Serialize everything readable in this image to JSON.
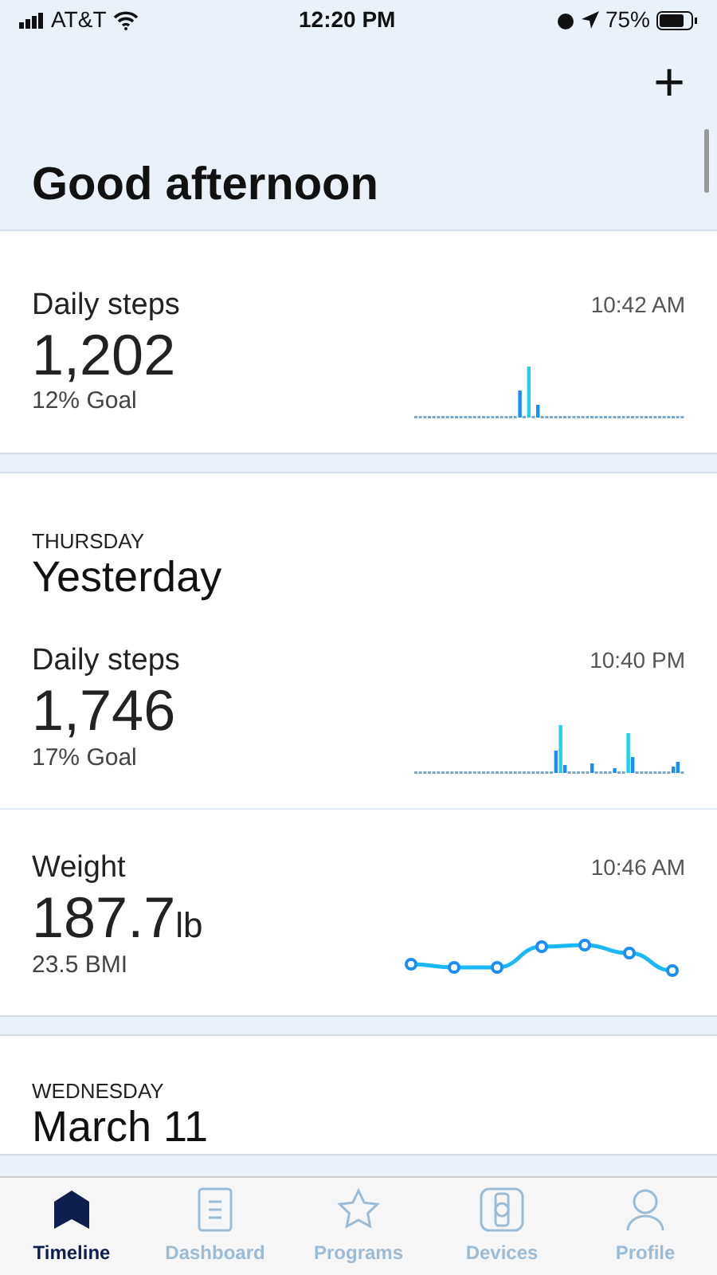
{
  "status_bar": {
    "carrier": "AT&T",
    "time": "12:20 PM",
    "battery": "75%"
  },
  "header": {
    "add_button": "+",
    "greeting": "Good afternoon"
  },
  "sections": [
    {
      "entries": [
        {
          "kind": "steps",
          "title": "Daily steps",
          "time": "10:42 AM",
          "value": "1,202",
          "sub": "12% Goal"
        }
      ]
    },
    {
      "weekday": "THURSDAY",
      "day": "Yesterday",
      "entries": [
        {
          "kind": "steps",
          "title": "Daily steps",
          "time": "10:40 PM",
          "value": "1,746",
          "sub": "17% Goal"
        },
        {
          "kind": "weight",
          "title": "Weight",
          "time": "10:46 AM",
          "value": "187.7",
          "unit": "lb",
          "sub": "23.5 BMI"
        }
      ]
    },
    {
      "weekday": "WEDNESDAY",
      "day": "March 11"
    }
  ],
  "tabs": [
    {
      "label": "Timeline",
      "selected": true
    },
    {
      "label": "Dashboard",
      "selected": false
    },
    {
      "label": "Programs",
      "selected": false
    },
    {
      "label": "Devices",
      "selected": false
    },
    {
      "label": "Profile",
      "selected": false
    }
  ]
}
